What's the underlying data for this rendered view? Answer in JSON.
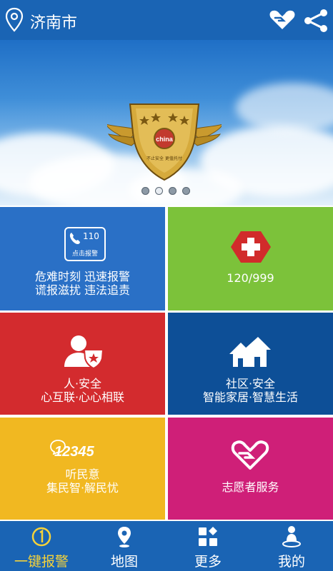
{
  "header": {
    "city": "济南市",
    "location_icon": "location-pin-icon",
    "heart_icon": "heart-hand-icon",
    "share_icon": "share-icon"
  },
  "banner": {
    "badge_emblem_text": "china",
    "badge_motto": "不止安全 更值托付",
    "carousel_total": 4,
    "carousel_active_index": 1
  },
  "tiles": {
    "alarm": {
      "icon_text": "110",
      "icon_label": "点击报警",
      "line1": "危难时刻 迅速报警",
      "line2": "谎报滋扰 违法追责",
      "color": "#2a70c6"
    },
    "emergency": {
      "line1": "120/999",
      "color": "#7cc23a"
    },
    "people": {
      "line1": "人·安全",
      "line2": "心互联·心心相联",
      "color": "#d32b2e"
    },
    "community": {
      "line1": "社区·安全",
      "line2": "智能家居·智慧生活",
      "color": "#0d4f97"
    },
    "hotline": {
      "icon_text": "12345",
      "line1": "听民意",
      "line2": "集民智·解民忧",
      "color": "#f1b821"
    },
    "volunteer": {
      "line1": "志愿者服务",
      "color": "#cf1f78"
    }
  },
  "nav": {
    "items": [
      {
        "label": "一键报警",
        "icon": "one-key-alarm-icon",
        "active": true
      },
      {
        "label": "地图",
        "icon": "map-pin-icon",
        "active": false
      },
      {
        "label": "更多",
        "icon": "grid-more-icon",
        "active": false
      },
      {
        "label": "我的",
        "icon": "person-icon",
        "active": false
      }
    ],
    "active_color": "#f5d23a",
    "bar_color": "#1a64b4"
  }
}
